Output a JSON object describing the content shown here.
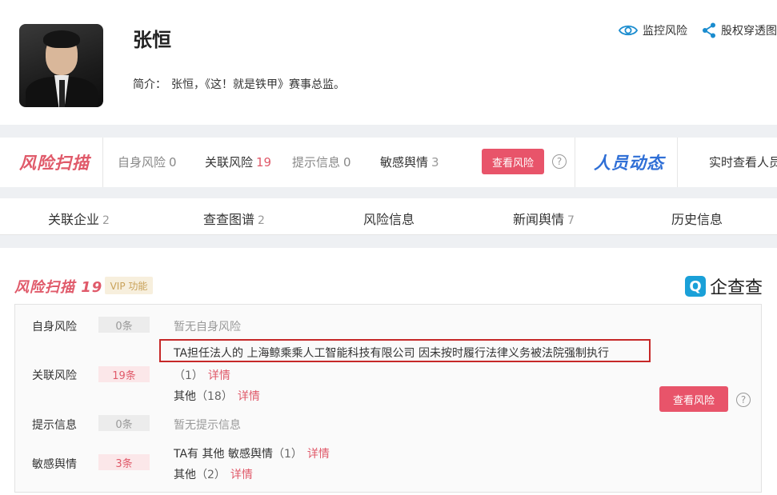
{
  "profile": {
    "name": "张恒",
    "intro_label": "简介：",
    "intro_text": "张恒，《这！就是铁甲》赛事总监。",
    "actions": [
      {
        "label": "监控风险",
        "icon": "eye-icon"
      },
      {
        "label": "股权穿透图",
        "icon": "share-icon"
      }
    ]
  },
  "scan_bar": {
    "title": "风险扫描",
    "stats": [
      {
        "label": "自身风险",
        "count": "0"
      },
      {
        "label": "关联风险",
        "count": "19"
      },
      {
        "label": "提示信息",
        "count": "0"
      },
      {
        "label": "敏感舆情",
        "count": "3"
      }
    ],
    "button": "查看风险",
    "help": "?",
    "person_title": "人员动态",
    "realtime_text": "实时查看人员"
  },
  "tabs": [
    {
      "label": "关联企业",
      "count": "2"
    },
    {
      "label": "查查图谱",
      "count": "2"
    },
    {
      "label": "风险信息",
      "count": ""
    },
    {
      "label": "新闻舆情",
      "count": "7"
    },
    {
      "label": "历史信息",
      "count": ""
    }
  ],
  "card": {
    "title": "风险扫描 19",
    "vip": "VIP 功能",
    "brand": {
      "logo": "Q",
      "name": "企查查"
    },
    "rows": [
      {
        "label": "自身风险",
        "count": "0条",
        "text": "暂无自身风险"
      },
      {
        "label": "关联风险",
        "count": "19条",
        "line1": "TA担任法人的 上海鲸乘乘人工智能科技有限公司 因未按时履行法律义务被法院强制执行",
        "line2_count": "（1）",
        "line2_link": "详情",
        "line3_prefix": "其他",
        "line3_count": "（18）",
        "line3_link": "详情"
      },
      {
        "label": "提示信息",
        "count": "0条",
        "text": "暂无提示信息"
      },
      {
        "label": "敏感舆情",
        "count": "3条",
        "line1_prefix": "TA有 其他 敏感舆情",
        "line1_count": "（1）",
        "line1_link": "详情",
        "line2_prefix": "其他",
        "line2_count": "（2）",
        "line2_link": "详情"
      }
    ],
    "button": "查看风险",
    "help": "?"
  },
  "colors": {
    "accent_red": "#e8546a",
    "brand_blue": "#1aa0d8",
    "highlight": "#c62828"
  }
}
